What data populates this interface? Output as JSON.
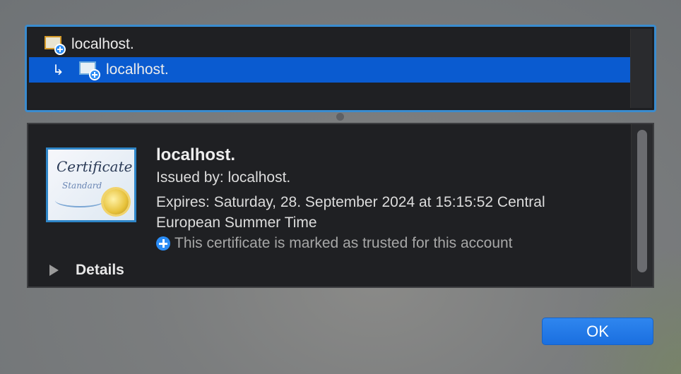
{
  "chain": {
    "items": [
      {
        "label": "localhost.",
        "icon": "certificate-root-icon"
      },
      {
        "label": "localhost.",
        "icon": "certificate-leaf-icon",
        "selected": true,
        "prefix": "↳"
      }
    ]
  },
  "detail": {
    "title": "localhost.",
    "issued_by": "Issued by: localhost.",
    "expires": "Expires: Saturday, 28. September 2024 at 15:15:52 Central European Summer Time",
    "trust_status": "This certificate is marked as trusted for this account",
    "details_label": "Details",
    "certificate_graphic": {
      "heading": "Certificate",
      "subheading": "Standard"
    }
  },
  "buttons": {
    "ok_label": "OK"
  },
  "colors": {
    "selection": "#0a5bd0",
    "accent": "#2a8cf5",
    "focus_ring": "#3a8ccf"
  }
}
